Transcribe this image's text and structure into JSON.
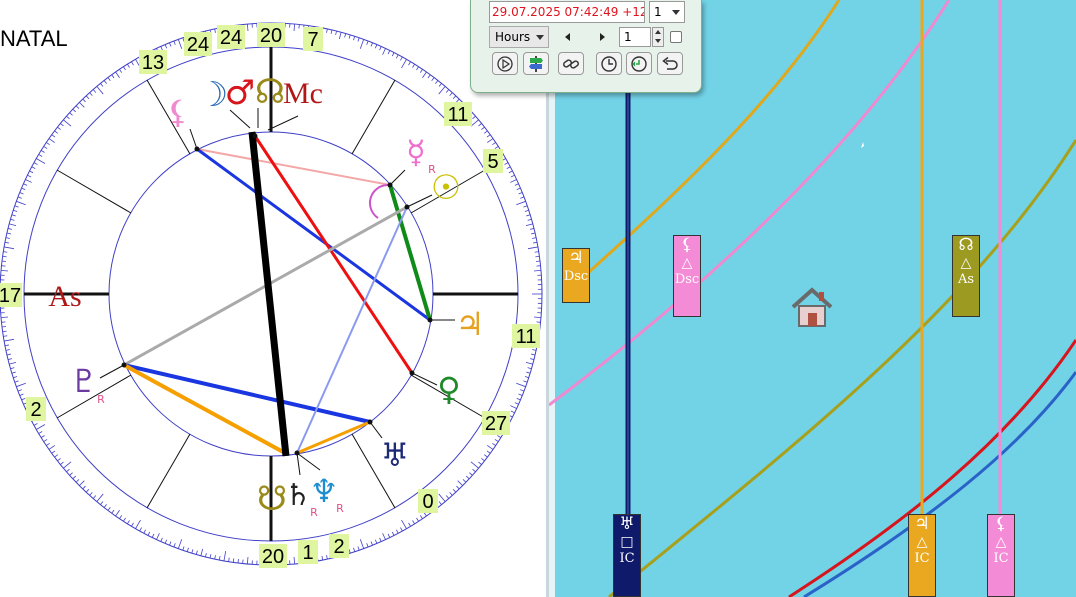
{
  "chart_title": "NATAL",
  "wheel": {
    "cusp_labels": [
      {
        "name": "asc",
        "text": "17"
      },
      {
        "name": "c2",
        "text": "2"
      },
      {
        "name": "c3",
        "text": "20"
      },
      {
        "name": "c3b",
        "text": "1"
      },
      {
        "name": "c4",
        "text": "2"
      },
      {
        "name": "c5",
        "text": "0"
      },
      {
        "name": "c6",
        "text": "27"
      },
      {
        "name": "c7",
        "text": "11"
      },
      {
        "name": "c8",
        "text": "5"
      },
      {
        "name": "c9",
        "text": "11"
      },
      {
        "name": "c10",
        "text": "7"
      },
      {
        "name": "mc",
        "text": "20"
      },
      {
        "name": "c11",
        "text": "24"
      },
      {
        "name": "c11b",
        "text": "24"
      },
      {
        "name": "c12",
        "text": "13"
      }
    ],
    "axis_labels": {
      "asc": "As",
      "mc": "Mc"
    },
    "planets": [
      {
        "name": "moon",
        "glyph": "☽",
        "color": "#2a6db5",
        "retro": ""
      },
      {
        "name": "mars",
        "glyph": "♂",
        "color": "#d8141c",
        "retro": ""
      },
      {
        "name": "north-node",
        "glyph": "☊",
        "color": "#9a8a1a",
        "retro": ""
      },
      {
        "name": "lilith",
        "glyph": "⚸",
        "color": "#f08ad0",
        "retro": ""
      },
      {
        "name": "mercury",
        "glyph": "☿",
        "color": "#ee6fd0",
        "retro": "R"
      },
      {
        "name": "sun",
        "glyph": "☉",
        "color": "#c9c000",
        "retro": ""
      },
      {
        "name": "jupiter",
        "glyph": "♃",
        "color": "#e6a020",
        "retro": ""
      },
      {
        "name": "venus",
        "glyph": "♀",
        "color": "#1f8a2a",
        "retro": ""
      },
      {
        "name": "uranus",
        "glyph": "♅",
        "color": "#1c2a78",
        "retro": ""
      },
      {
        "name": "neptune",
        "glyph": "♆",
        "color": "#1f8ed0",
        "retro": "R"
      },
      {
        "name": "saturn",
        "glyph": "♄",
        "color": "#222222",
        "retro": "R"
      },
      {
        "name": "south-node",
        "glyph": "☋",
        "color": "#9a8a1a",
        "retro": ""
      },
      {
        "name": "pluto",
        "glyph": "♇",
        "color": "#6a3aa0",
        "retro": "R"
      }
    ]
  },
  "toolbar": {
    "datetime": "29.07.2025   07:42:49 +12",
    "step_select": "1",
    "unit_select": "Hours",
    "step_value": "1"
  },
  "map": {
    "badges": [
      {
        "name": "jupiter-dsc",
        "symbol": "♃",
        "aspect": "",
        "label": "Dsc",
        "bg": "#e9a820"
      },
      {
        "name": "lilith-dsc",
        "symbol": "⚸",
        "aspect": "△",
        "label": "Dsc",
        "bg": "#f48bd6"
      },
      {
        "name": "node-as",
        "symbol": "☊",
        "aspect": "△",
        "label": "As",
        "bg": "#9c9a20"
      },
      {
        "name": "uranus-ic",
        "symbol": "♅",
        "aspect": "□",
        "label": "IC",
        "bg": "#0f1a6a"
      },
      {
        "name": "jupiter-ic",
        "symbol": "♃",
        "aspect": "△",
        "label": "IC",
        "bg": "#e9a820"
      },
      {
        "name": "lilith-ic",
        "symbol": "⚸",
        "aspect": "△",
        "label": "IC",
        "bg": "#f48bd6"
      }
    ]
  }
}
